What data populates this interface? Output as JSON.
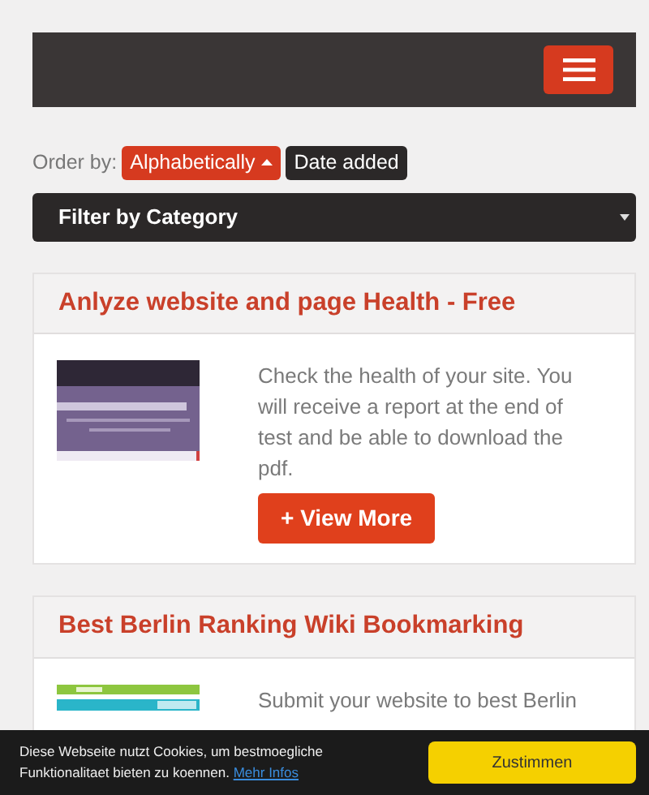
{
  "order_by": {
    "label": "Order by:",
    "options": [
      {
        "label": "Alphabetically",
        "selected": true
      },
      {
        "label": "Date added",
        "selected": false
      }
    ]
  },
  "filter": {
    "label": "Filter by Category"
  },
  "cards": [
    {
      "title": "Anlyze website and page Health - Free",
      "description": "Check the health of your site. You will receive a report at the end of test and be able to download the pdf.",
      "button": {
        "icon": "+",
        "label": "View More"
      }
    },
    {
      "title": "Best Berlin Ranking Wiki Bookmarking",
      "description": "Submit your website to best Berlin"
    }
  ],
  "cookie_bar": {
    "text": "Diese Webseite nutzt Cookies, um bestmoegliche Funktionalitaet bieten zu koennen.",
    "link": "Mehr Infos",
    "button": "Zustimmen"
  }
}
